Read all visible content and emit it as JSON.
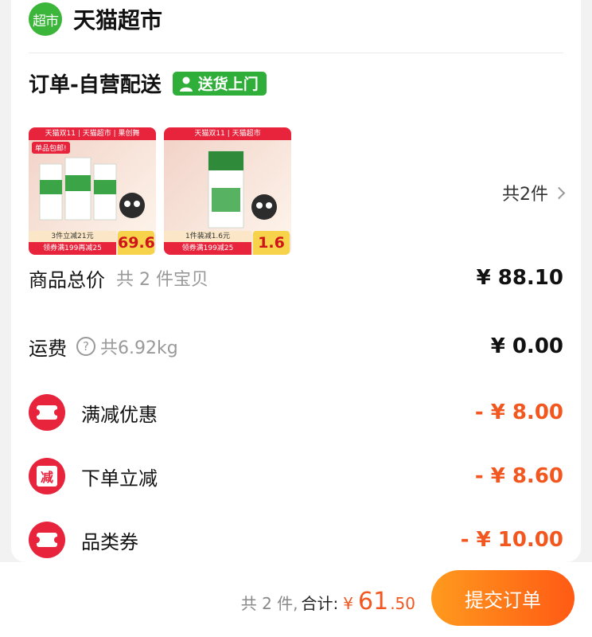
{
  "store": {
    "logo_text": "超市",
    "name": "天猫超市"
  },
  "shipping": {
    "title": "订单-自营配送",
    "badge": "送货上门"
  },
  "products": [
    {
      "top_text": "天猫双11 | 天猫超市 | 果创舞",
      "tag": "单品包邮!",
      "promo": "3件立减21元",
      "coupon": "领券满199再减25",
      "price": "69.6"
    },
    {
      "top_text": "天猫双11 | 天猫超市",
      "tag": "",
      "promo": "1件装减1.6元",
      "coupon": "领券满199减25",
      "price": "1.6"
    }
  ],
  "item_count": "共2件",
  "summary": {
    "goods_label": "商品总价",
    "goods_sub": "共 2 件宝贝",
    "goods_amount": "¥ 88.10",
    "freight_label": "运费",
    "freight_help": "?",
    "freight_weight": "共6.92kg",
    "freight_amount": "¥ 0.00"
  },
  "discounts": [
    {
      "icon": "ticket-icon",
      "label": "满减优惠",
      "amount": "- ¥ 8.00"
    },
    {
      "icon": "jian-icon",
      "icon_text": "减",
      "label": "下单立减",
      "amount": "- ¥ 8.60"
    },
    {
      "icon": "ticket-icon",
      "label": "品类券",
      "amount": "- ¥ 10.00"
    }
  ],
  "footer": {
    "count_text": "共 2 件,",
    "sum_label": "合计:",
    "currency": "¥",
    "total_int": "61",
    "total_dec": ".50",
    "submit_label": "提交订单"
  },
  "colors": {
    "accent": "#f1571f",
    "red": "#e8233c",
    "green": "#2fae3a"
  }
}
